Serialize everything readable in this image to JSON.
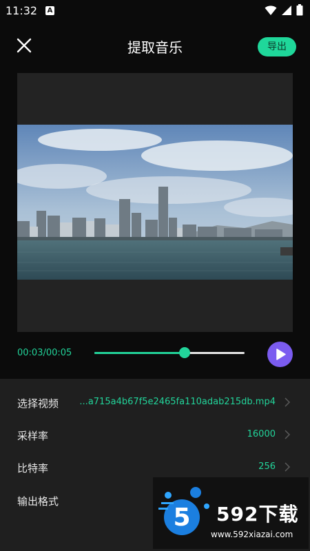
{
  "status_bar": {
    "time": "11:32",
    "notification_icon": "a-notification-icon",
    "wifi_icon": "wifi-icon",
    "signal_icon": "signal-icon",
    "battery_icon": "battery-icon"
  },
  "header": {
    "title": "提取音乐",
    "close_icon": "close-icon",
    "export_label": "导出"
  },
  "player": {
    "time": "00:03/00:05",
    "progress": 0.6,
    "play_icon": "play-icon"
  },
  "settings": [
    {
      "label": "选择视频",
      "value": "...a715a4b67f5e2465fa110adab215db.mp4"
    },
    {
      "label": "采样率",
      "value": "16000"
    },
    {
      "label": "比特率",
      "value": "256"
    },
    {
      "label": "输出格式",
      "value": ""
    }
  ],
  "watermark": {
    "brand": "592下载",
    "url": "www.592xiazai.com",
    "logo_digit": "5"
  },
  "colors": {
    "accent": "#22d49a",
    "play": "#7b5cf0",
    "background": "#0b0b0b",
    "panel": "#1f1f1f"
  }
}
